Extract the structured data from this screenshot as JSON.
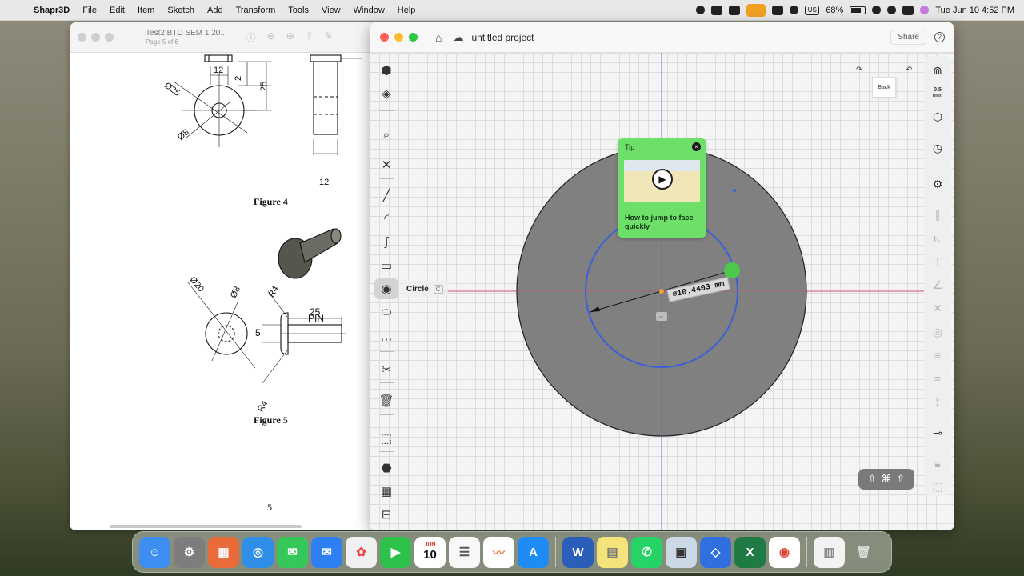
{
  "menubar": {
    "app": "Shapr3D",
    "items": [
      "File",
      "Edit",
      "Item",
      "Sketch",
      "Add",
      "Transform",
      "Tools",
      "View",
      "Window",
      "Help"
    ],
    "battery": "68%",
    "input_source": "US",
    "clock": "Tue Jun 10  4:52 PM"
  },
  "preview": {
    "title": "Test2 BTD SEM 1 20...",
    "subtitle": "Page 5 of 6",
    "figure4": {
      "caption": "Figure 4",
      "dims": [
        "12",
        "2",
        "25",
        "Ø25",
        "Ø8",
        "12"
      ]
    },
    "figure5": {
      "caption": "Figure 5",
      "pin_label": "PIN",
      "dims": [
        "Ø20",
        "Ø8",
        "R4",
        "25",
        "5",
        "R4"
      ]
    },
    "page_number": "5"
  },
  "shapr": {
    "project_name": "untitled project",
    "share_label": "Share",
    "help_glyph": "?",
    "active_tool_tip": "Circle",
    "active_tool_key": "C",
    "viewcube_label": "Back",
    "grid_size": "0.5\nmm",
    "tip": {
      "heading": "Tip",
      "text": "How to jump to face quickly"
    },
    "dimension_value": "⌀10.4403 mm",
    "keyboard_pill": [
      "⇧",
      "⌘",
      "⇧"
    ],
    "colors": {
      "circle_fill": "#808080",
      "sketch_circle": "#3a5fd6",
      "tip_green": "#6ee06a",
      "axis_red": "#e04b8a",
      "axis_blue": "#6a6ae0"
    }
  },
  "dock": {
    "calendar_month": "JUN",
    "calendar_day": "10"
  }
}
